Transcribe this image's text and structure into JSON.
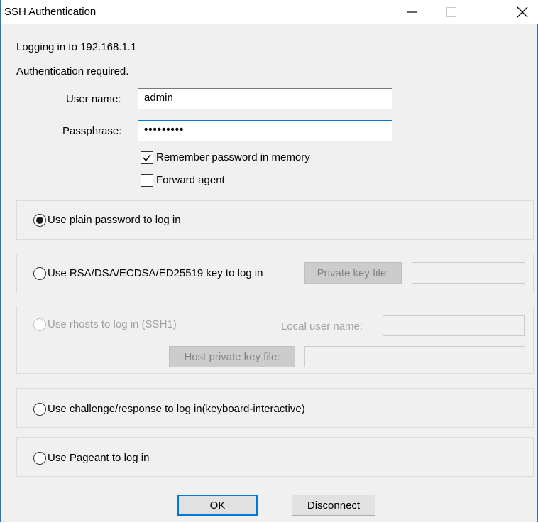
{
  "window": {
    "title": "SSH Authentication"
  },
  "icons": {
    "minimize": "minimize-icon",
    "maximize": "maximize-icon",
    "close": "close-icon"
  },
  "header": {
    "logging_in": "Logging in to 192.168.1.1",
    "auth_required": "Authentication required."
  },
  "form": {
    "username_label": "User name:",
    "username_value": "admin",
    "passphrase_label": "Passphrase:",
    "passphrase_value": "•••••••••",
    "remember_label": "Remember password in memory",
    "remember_checked": true,
    "forward_label": "Forward agent",
    "forward_checked": false
  },
  "methods": {
    "plain": {
      "label": "Use plain password to log in",
      "selected": true
    },
    "rsa": {
      "label": "Use RSA/DSA/ECDSA/ED25519 key to log in",
      "button": "Private key file:",
      "field_value": ""
    },
    "rhosts": {
      "label": "Use rhosts to log in (SSH1)",
      "local_user_label": "Local user name:",
      "host_key_button": "Host private key file:",
      "field_value": ""
    },
    "challenge": {
      "label": "Use challenge/response to log in(keyboard-interactive)"
    },
    "pageant": {
      "label": "Use Pageant to log in"
    }
  },
  "buttons": {
    "ok": "OK",
    "disconnect": "Disconnect"
  },
  "colors": {
    "focus_border": "#0078d7",
    "window_border": "#3c6ea5",
    "dialog_bg": "#f0f0f0"
  }
}
